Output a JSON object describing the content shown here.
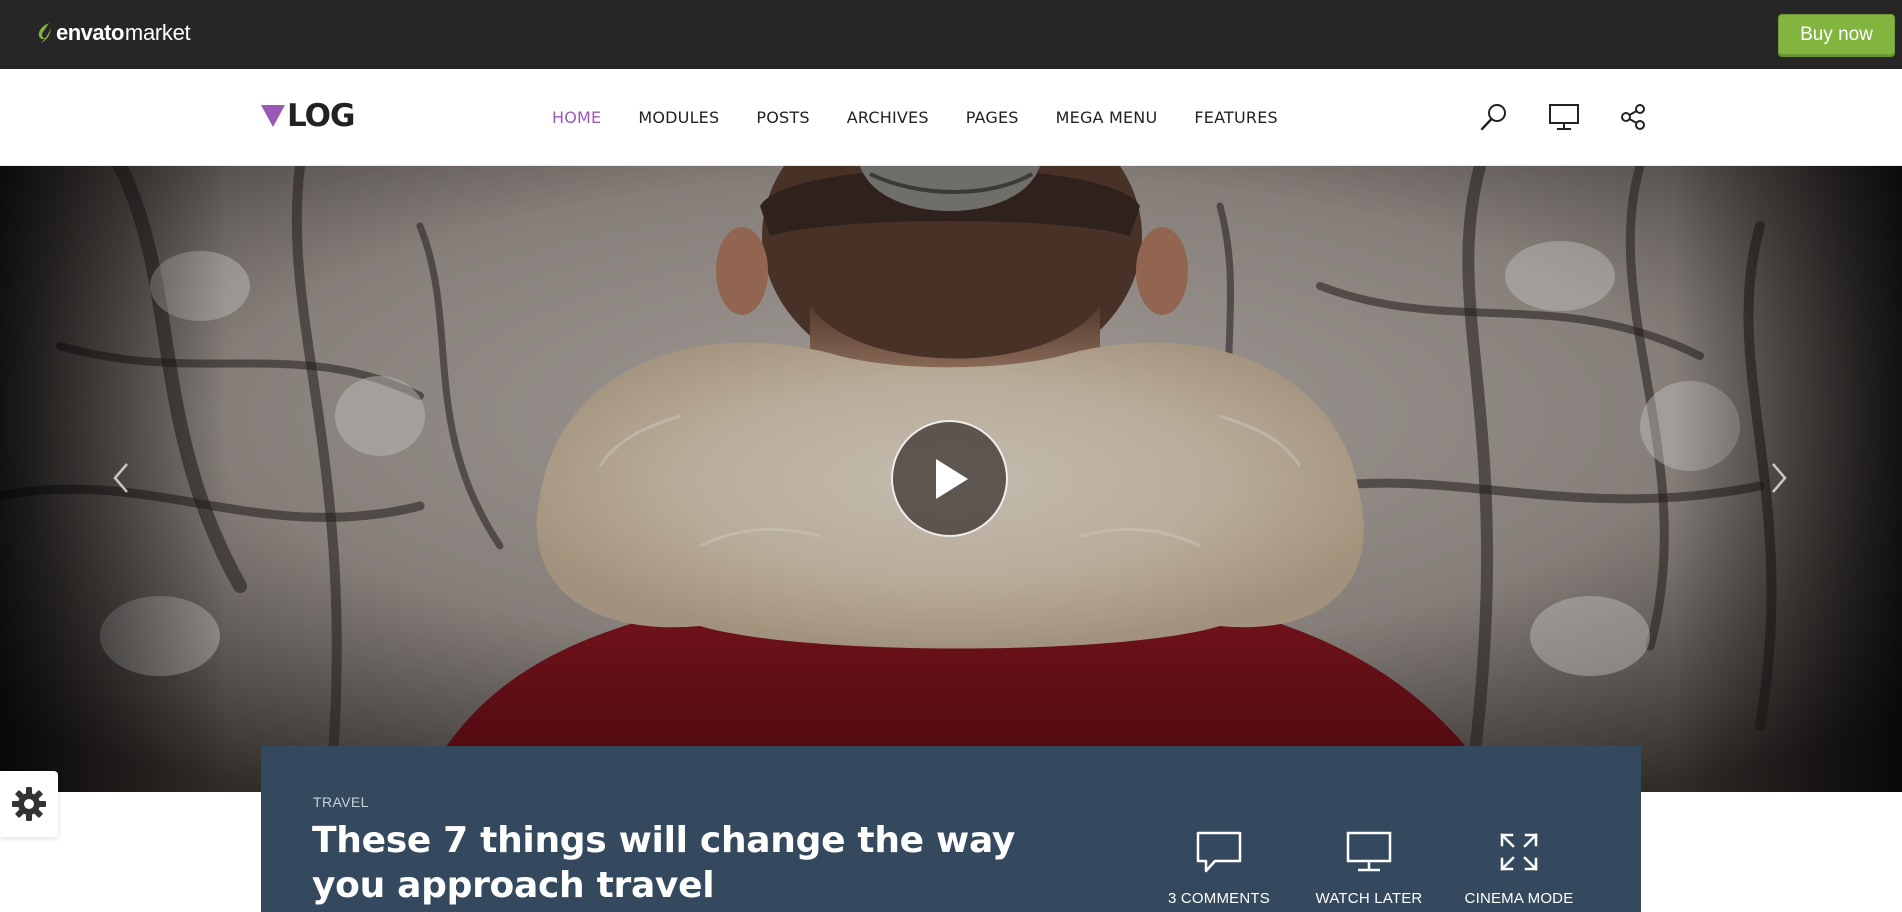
{
  "envato_bar": {
    "logo_word": "envato",
    "logo_market": "market",
    "buy_now_label": "Buy now",
    "colors": {
      "background": "#262626",
      "buy_button": "#82b440"
    }
  },
  "header": {
    "brand": "LOG",
    "brand_accent_color": "#9b59b6",
    "nav": [
      {
        "label": "HOME",
        "active": true
      },
      {
        "label": "MODULES",
        "active": false
      },
      {
        "label": "POSTS",
        "active": false
      },
      {
        "label": "ARCHIVES",
        "active": false
      },
      {
        "label": "PAGES",
        "active": false
      },
      {
        "label": "MEGA MENU",
        "active": false
      },
      {
        "label": "FEATURES",
        "active": false
      }
    ],
    "icons": [
      "search-icon",
      "tv-icon",
      "share-icon"
    ]
  },
  "hero": {
    "icons": [
      "chevron-left-icon",
      "play-icon",
      "chevron-right-icon"
    ]
  },
  "post": {
    "category": "TRAVEL",
    "title": "These 7 things will change the way you approach travel",
    "panel_color": "#34495e",
    "actions": [
      {
        "icon": "comment-icon",
        "label": "3 COMMENTS"
      },
      {
        "icon": "monitor-icon",
        "label": "WATCH LATER"
      },
      {
        "icon": "expand-icon",
        "label": "CINEMA MODE"
      }
    ]
  },
  "settings": {
    "icon": "gear-icon"
  }
}
